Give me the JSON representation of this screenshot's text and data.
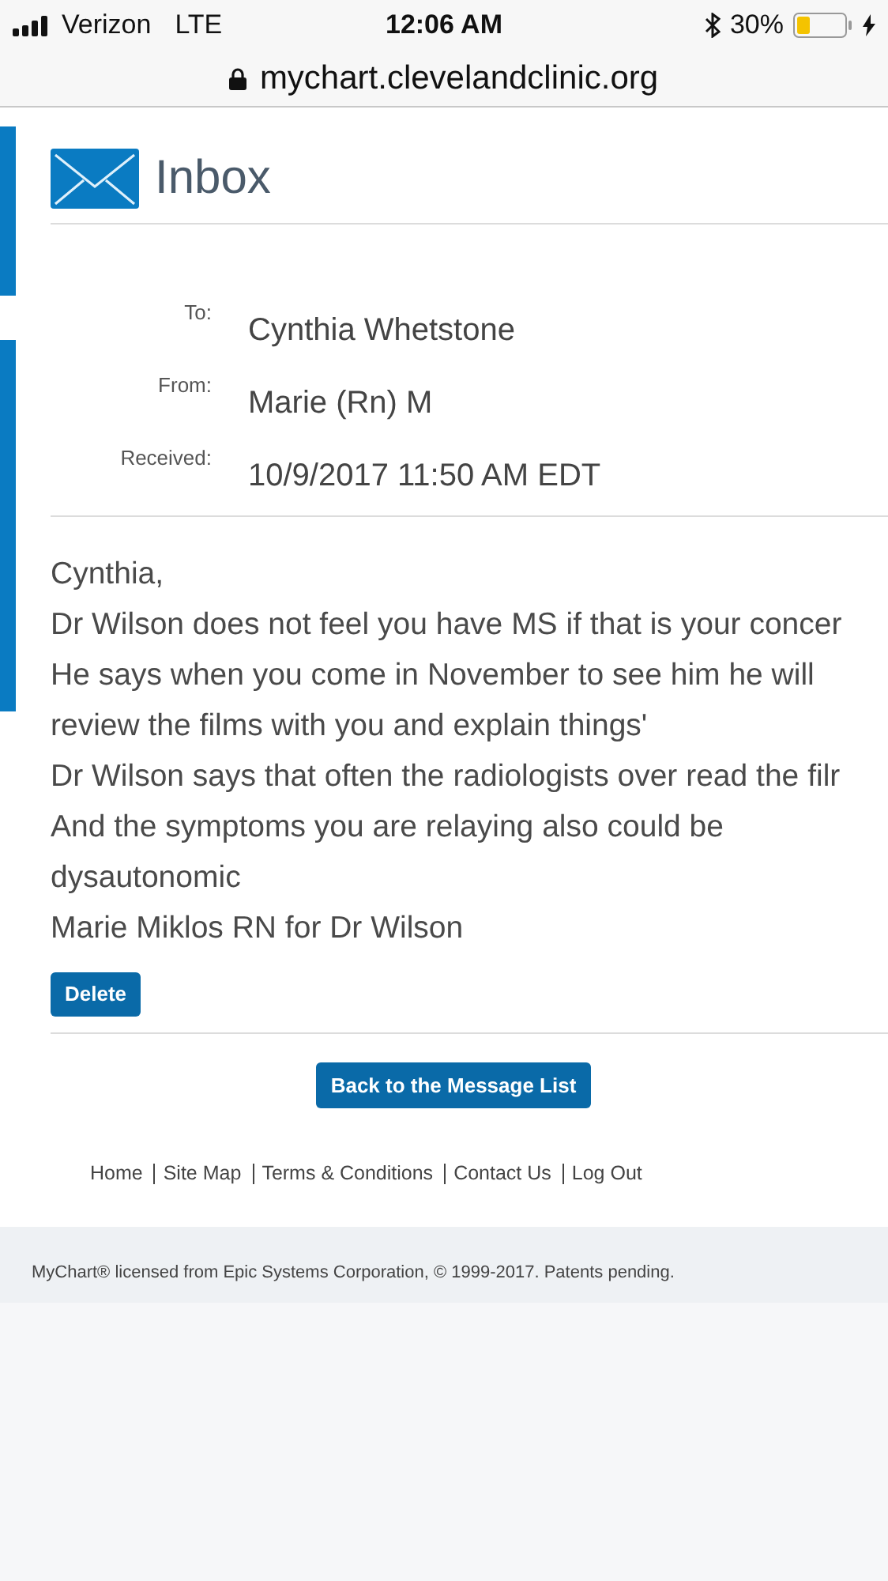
{
  "status_bar": {
    "carrier": "Verizon",
    "network": "LTE",
    "time": "12:06 AM",
    "battery": "30%"
  },
  "address_bar": {
    "url": "mychart.clevelandclinic.org"
  },
  "page": {
    "title": "Inbox"
  },
  "message": {
    "fields": [
      {
        "label": "To:",
        "value": "Cynthia Whetstone"
      },
      {
        "label": "From:",
        "value": "Marie (Rn) M"
      },
      {
        "label": "Received:",
        "value": "10/9/2017 11:50 AM EDT"
      }
    ],
    "body_lines": [
      "Cynthia,",
      "Dr Wilson does not feel you have MS if that is your concer",
      "He says when you come in November to see him he will",
      "review the films with you and explain things'",
      "Dr Wilson says that often the radiologists over read the filr",
      "And the symptoms you are relaying also could be",
      "dysautonomic",
      "Marie Miklos RN for Dr Wilson"
    ],
    "delete_button": "Delete"
  },
  "back_button": "Back to the Message List",
  "footer_links": [
    "Home",
    "Site Map",
    "Terms & Conditions",
    "Contact Us",
    "Log Out"
  ],
  "copyright": "MyChart® licensed from Epic Systems Corporation, © 1999-2017. Patents pending."
}
